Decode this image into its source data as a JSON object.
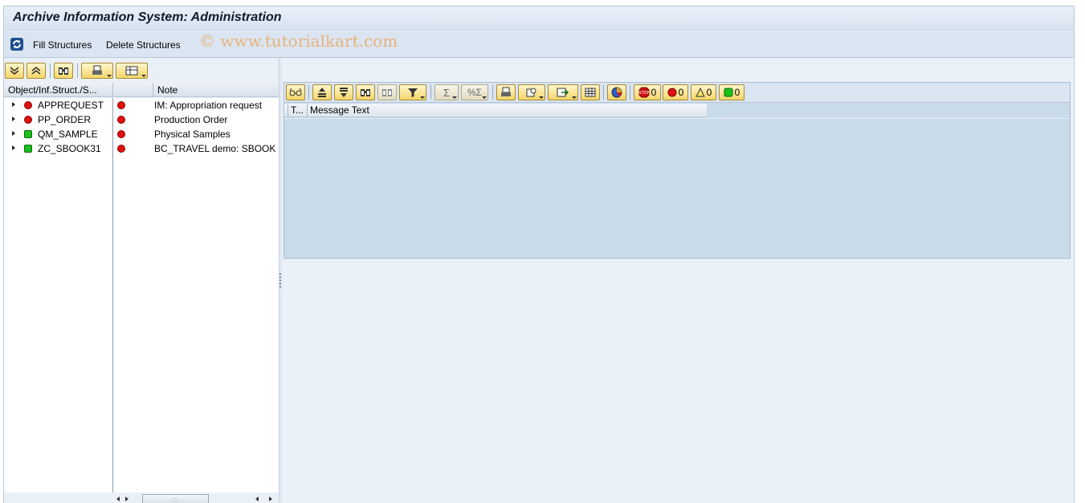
{
  "window": {
    "title": "Archive Information System: Administration"
  },
  "app_toolbar": {
    "fill_structures": "Fill Structures",
    "delete_structures": "Delete Structures",
    "watermark": "© www.tutorialkart.com"
  },
  "tree": {
    "columns": [
      "Object/Inf.Struct./S...",
      "",
      "Note"
    ],
    "rows": [
      {
        "name": "APPREQUEST",
        "status": "red",
        "note_status": "red",
        "note": "IM: Appropriation request"
      },
      {
        "name": "PP_ORDER",
        "status": "red",
        "note_status": "red",
        "note": "Production Order"
      },
      {
        "name": "QM_SAMPLE",
        "status": "green",
        "note_status": "red",
        "note": "Physical Samples"
      },
      {
        "name": "ZC_SBOOK31",
        "status": "green",
        "note_status": "red",
        "note": "BC_TRAVEL demo: SBOOK E"
      }
    ]
  },
  "messages": {
    "columns": [
      "T...",
      "Message Text"
    ],
    "counts": {
      "stop": "0",
      "error": "0",
      "warning": "0",
      "success": "0"
    }
  },
  "colors": {
    "red_lamp": "#e01010",
    "green_lamp": "#18c018",
    "button_yellow": "#f4d66a",
    "pane_blue": "#c9daeb"
  }
}
